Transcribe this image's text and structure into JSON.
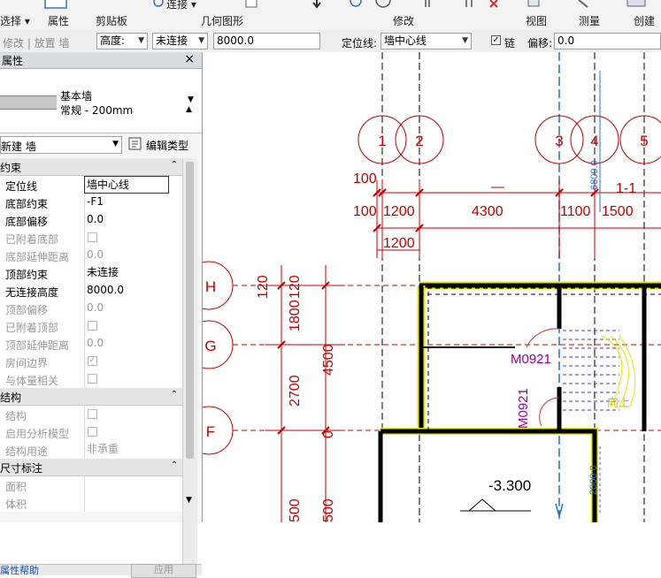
{
  "ribbon": {
    "groups": [
      "选择 ▾",
      "属性",
      "剪贴板",
      "几何图形",
      "修改",
      "视图",
      "测量",
      "创建"
    ],
    "tools": [
      "连接 ▾"
    ]
  },
  "options_bar": {
    "modify_place": "修改 | 放置 墙",
    "height_label": "高度:",
    "height_mode": "未连接",
    "height_value": "8000.0",
    "location_line_label": "定位线:",
    "location_line_value": "墙中心线",
    "chain_label": "链",
    "chain_checked": "✓",
    "offset_label": "偏移:",
    "offset_value": "0.0"
  },
  "properties": {
    "title": "属性",
    "close": "×",
    "type_family": "基本墙",
    "type_name": "常规 - 200mm",
    "instance_selector": "新建 墙",
    "edit_type": "编辑类型",
    "groups": {
      "constraints": "约束",
      "structure": "结构",
      "dimensions": "尺寸标注"
    },
    "rows": {
      "location_line": {
        "label": "定位线",
        "value": "墙中心线"
      },
      "base_constraint": {
        "label": "底部约束",
        "value": "-F1"
      },
      "base_offset": {
        "label": "底部偏移",
        "value": "0.0"
      },
      "base_attached": {
        "label": "已附着底部"
      },
      "base_extension": {
        "label": "底部延伸距离",
        "value": "0.0"
      },
      "top_constraint": {
        "label": "顶部约束",
        "value": "未连接"
      },
      "unconnected_height": {
        "label": "无连接高度",
        "value": "8000.0"
      },
      "top_offset": {
        "label": "顶部偏移",
        "value": "0.0"
      },
      "top_attached": {
        "label": "已附着顶部"
      },
      "top_extension": {
        "label": "顶部延伸距离",
        "value": "0.0"
      },
      "room_bounding": {
        "label": "房间边界",
        "check": "✓"
      },
      "related_to_mass": {
        "label": "与体量相关"
      },
      "structural": {
        "label": "结构"
      },
      "analytical_model": {
        "label": "启用分析模型"
      },
      "structural_usage": {
        "label": "结构用途",
        "value": "非承重"
      },
      "area": {
        "label": "面积"
      },
      "volume": {
        "label": "体积"
      }
    },
    "help_link": "属性帮助",
    "apply_button": "应用"
  },
  "drawing": {
    "grids_v": [
      "1",
      "2",
      "3",
      "4",
      "5"
    ],
    "grids_h": [
      "H",
      "G",
      "F"
    ],
    "dims_top": [
      "100",
      "100",
      "1200",
      "4300",
      "1100",
      "1500",
      "1200",
      "6800.0"
    ],
    "section_mark": "1-1",
    "dims_left": [
      "120",
      "120",
      "1800",
      "2700",
      "4500",
      "0",
      "500",
      "500"
    ],
    "doors": [
      "M0921",
      "M0921"
    ],
    "stair_label": "向上",
    "elevation": "-3.300",
    "dim_vertical_2": "2000.0",
    "colors": {
      "grid": "#c00000",
      "door_tag": "#990099",
      "stair": "#e8e800",
      "walls": "#000000",
      "temp_dim": "#1f5fbf"
    }
  }
}
